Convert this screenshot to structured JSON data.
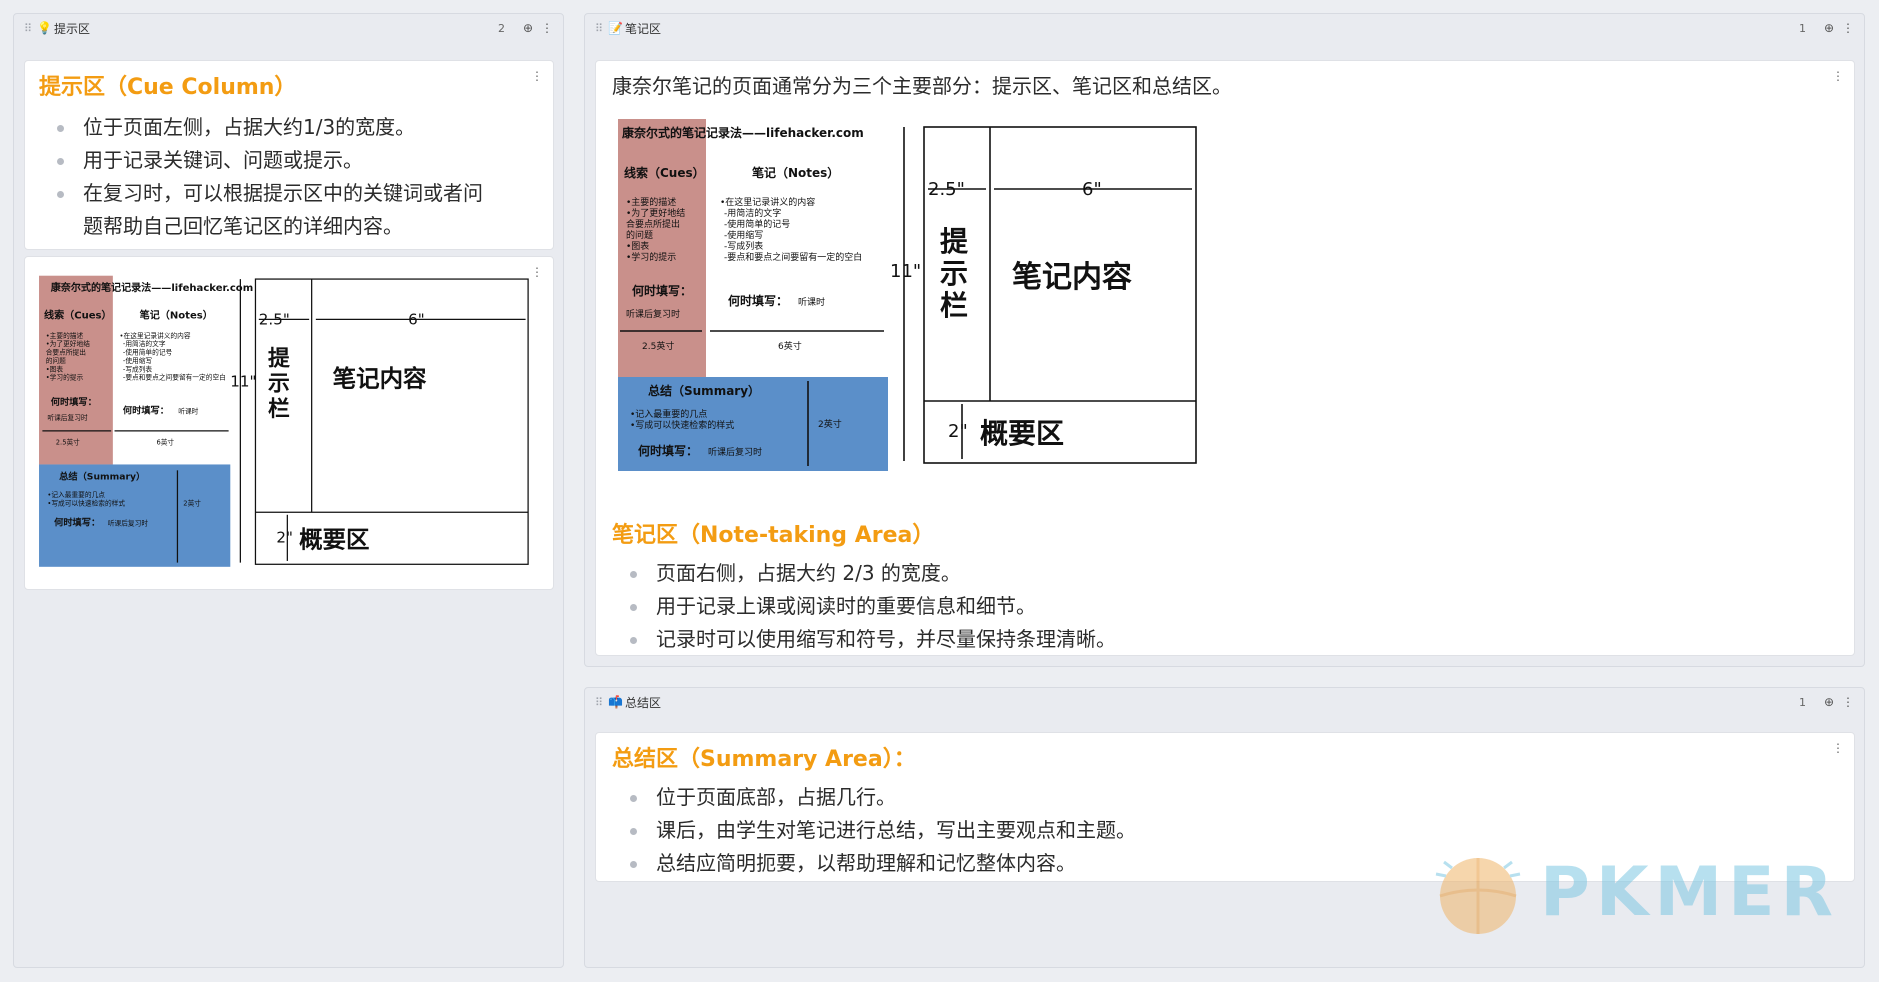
{
  "columns": {
    "cue": {
      "title": "提示区",
      "icon": "lightbulb-icon",
      "count": "2"
    },
    "notes": {
      "title": "笔记区",
      "icon": "memo-icon",
      "count": "1"
    },
    "summary": {
      "title": "总结区",
      "icon": "mailbox-icon",
      "count": "1"
    }
  },
  "cue_card": {
    "heading": "提示区（Cue Column）",
    "items": [
      "位于页面左侧，占据大约1/3的宽度。",
      "用于记录关键词、问题或提示。",
      "在复习时，可以根据提示区中的关键词或者问",
      "题帮助自己回忆笔记区的详细内容。"
    ]
  },
  "notes_card": {
    "intro": "康奈尔笔记的页面通常分为三个主要部分：提示区、笔记区和总结区。",
    "heading": "笔记区（Note-taking Area）",
    "items": [
      "页面右侧，占据大约 2/3 的宽度。",
      "用于记录上课或阅读时的重要信息和细节。",
      "记录时可以使用缩写和符号，并尽量保持条理清晰。"
    ]
  },
  "summary_card": {
    "heading": "总结区（Summary Area）：",
    "items": [
      "位于页面底部，占据几行。",
      "课后，由学生对笔记进行总结，写出主要观点和主题。",
      "总结应简明扼要，以帮助理解和记忆整体内容。"
    ]
  },
  "diagram": {
    "site": "康奈尔式的笔记记录法——lifehacker.com",
    "cues_label": "线索（Cues）",
    "notes_label": "笔记（Notes）",
    "cues_lines": [
      "•主要的描述",
      "•为了更好地结",
      "  合要点所提出",
      "  的问题",
      "•图表",
      "•学习的提示"
    ],
    "notes_lines": [
      "•在这里记录讲义的内容",
      "-用简洁的文字",
      "-使用简单的记号",
      "-使用缩写",
      "-写成列表",
      "-要点和要点之间要留有一定的空白"
    ],
    "when_label": "何时填写：",
    "cues_when": "听课后复习时",
    "notes_when": "听课时",
    "cues_width": "2.5英寸",
    "notes_width": "6英寸",
    "summary_label": "总结（Summary）",
    "summary_lines": [
      "•记入最重要的几点",
      "•写成可以快速检索的样式"
    ],
    "summary_when": "听课后复习时",
    "summary_height": "2英寸",
    "dim_left": "2.5\"",
    "dim_right": "6\"",
    "dim_height": "11\"",
    "dim_bottom": "2\"",
    "cue_area": [
      "提",
      "示",
      "栏"
    ],
    "notes_area": "笔记内容",
    "summary_area": "概要区"
  },
  "watermark": "PKMER",
  "controls": {
    "add": "⊕",
    "more": "⋮",
    "grip": "⠿"
  },
  "colors": {
    "accent": "#f39c12",
    "cue_pink": "#c9908b",
    "summary_blue": "#5b8fc9"
  }
}
